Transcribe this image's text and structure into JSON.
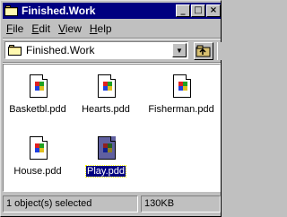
{
  "window": {
    "title": "Finished.Work",
    "buttons": {
      "minimize": "_",
      "maximize": "□",
      "close": "×"
    }
  },
  "menu": [
    {
      "underline": "F",
      "rest": "ile"
    },
    {
      "underline": "E",
      "rest": "dit"
    },
    {
      "underline": "V",
      "rest": "iew"
    },
    {
      "underline": "H",
      "rest": "elp"
    }
  ],
  "address": {
    "value": "Finished.Work",
    "dropdown_glyph": "▼"
  },
  "files": [
    {
      "label": "Basketbl.pdd",
      "selected": false
    },
    {
      "label": "Hearts.pdd",
      "selected": false
    },
    {
      "label": "Fisherman.pdd",
      "selected": false
    },
    {
      "label": "House.pdd",
      "selected": false
    },
    {
      "label": "Play.pdd",
      "selected": true
    }
  ],
  "status": {
    "selection": "1 object(s) selected",
    "size": "130KB"
  },
  "colors": {
    "titlebar": "#000080",
    "face": "#c0c0c0",
    "selection": "#000080"
  }
}
